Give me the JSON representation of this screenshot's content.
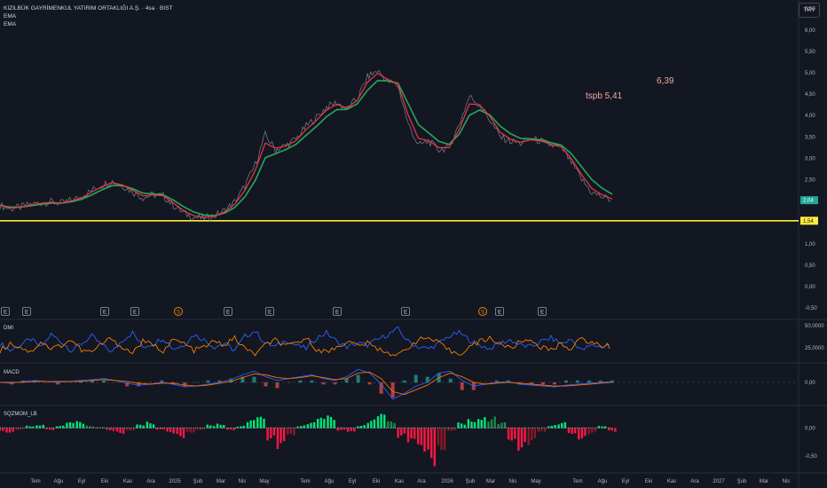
{
  "header": {
    "title": "KIZILBÜK GAYRİMENKUL YATIRIM ORTAKLIĞI A.Ş. · 4sa · BIST",
    "indicator1": "EMA",
    "indicator2": "EMA",
    "currency": "TRY"
  },
  "annotations": {
    "tspb": "tspb 5,41",
    "price_target": "6,39"
  },
  "colors": {
    "background": "#131722",
    "ema_fast": "#f23645",
    "ema_slow": "#26a65b",
    "support_line": "#ffeb3b",
    "dmi_plus": "#2962ff",
    "dmi_minus": "#f57c00",
    "squeeze_up": "#00e676",
    "squeeze_down": "#ff1744",
    "price_badge": "#26a69a"
  },
  "chart_data": [
    {
      "type": "line",
      "name": "price",
      "y_tick_labels": [
        "6,50",
        "6,00",
        "5,50",
        "5,00",
        "4,50",
        "4,00",
        "3,50",
        "3,00",
        "2,50",
        "2,00",
        "1,50",
        "1,00",
        "0,50",
        "0,00",
        "-0,50"
      ],
      "ylim": [
        -0.6,
        6.7
      ],
      "x_tick_labels": [
        "Tem",
        "Ağu",
        "Eyl",
        "Eki",
        "Kas",
        "Ara",
        "2025",
        "Şub",
        "Mar",
        "Nis",
        "May",
        "Tem",
        "Ağu",
        "Eyl",
        "Eki",
        "Kas",
        "Ara",
        "2026",
        "Şub",
        "Mar",
        "Nis",
        "May",
        "Tem",
        "Ağu",
        "Eyl",
        "Eki",
        "Kas",
        "Ara",
        "2027",
        "Şub",
        "Mar",
        "Nis"
      ],
      "series": [
        {
          "values": [
            1.9,
            1.82,
            1.86,
            1.92,
            1.96,
            1.98,
            1.95,
            2.02,
            2.1,
            2.25,
            2.38,
            2.46,
            2.36,
            2.22,
            2.08,
            2.15,
            2.12,
            1.9,
            1.72,
            1.62,
            1.6,
            1.65,
            1.78,
            1.98,
            2.35,
            2.85,
            3.55,
            3.2,
            3.3,
            3.45,
            3.75,
            3.95,
            4.2,
            4.3,
            4.15,
            4.4,
            4.9,
            5.05,
            4.8,
            4.7,
            3.8,
            3.3,
            3.4,
            3.2,
            3.25,
            3.8,
            4.45,
            4.25,
            3.9,
            3.5,
            3.4,
            3.35,
            3.45,
            3.4,
            3.3,
            3.25,
            2.9,
            2.5,
            2.2,
            2.1,
            2.02
          ]
        }
      ],
      "last_price": "2,04",
      "support_level": "1,54",
      "support_value": 1.54,
      "event_markers": [
        "E",
        "E",
        "E",
        "E",
        "S",
        "E",
        "E",
        "E",
        "E",
        "S",
        "E",
        "E"
      ]
    },
    {
      "type": "line",
      "name": "DMI",
      "y_tick_labels": [
        "50,0000",
        "25,0000"
      ],
      "series": [
        {
          "values": [
            30,
            22,
            28,
            35,
            25,
            40,
            32,
            22,
            30,
            38,
            28,
            20,
            34,
            42,
            26,
            30,
            36,
            24,
            28,
            40,
            34,
            26,
            30,
            22,
            38,
            44,
            30,
            26,
            34,
            28,
            24,
            36,
            42,
            32,
            26,
            30,
            28,
            34,
            40,
            46,
            32,
            26,
            24,
            30,
            38,
            42,
            34,
            28,
            24,
            30,
            34,
            28,
            26,
            32,
            36,
            30,
            34,
            22,
            28,
            26,
            30
          ]
        },
        {
          "values": [
            22,
            30,
            26,
            20,
            32,
            24,
            28,
            34,
            22,
            20,
            30,
            36,
            24,
            20,
            32,
            28,
            22,
            34,
            30,
            22,
            26,
            32,
            28,
            36,
            24,
            18,
            28,
            34,
            26,
            30,
            36,
            24,
            20,
            26,
            32,
            28,
            30,
            24,
            20,
            16,
            26,
            34,
            36,
            30,
            22,
            18,
            26,
            32,
            36,
            30,
            24,
            32,
            34,
            26,
            22,
            30,
            24,
            36,
            30,
            28,
            26
          ]
        }
      ]
    },
    {
      "type": "line",
      "name": "MACD",
      "y_tick_labels": [
        "0,00"
      ],
      "series": [
        {
          "values": [
            0.0,
            -0.01,
            0.01,
            0.02,
            0.01,
            0.0,
            0.01,
            0.02,
            0.03,
            0.04,
            0.02,
            -0.01,
            -0.03,
            -0.02,
            0.0,
            -0.02,
            -0.05,
            -0.04,
            -0.02,
            0.0,
            0.03,
            0.08,
            0.12,
            0.06,
            0.02,
            0.04,
            0.06,
            0.08,
            0.04,
            0.02,
            0.06,
            0.14,
            0.1,
            -0.02,
            -0.18,
            -0.12,
            -0.04,
            0.0,
            0.1,
            0.12,
            0.02,
            -0.04,
            -0.02,
            0.0,
            0.01,
            -0.02,
            -0.03,
            -0.04,
            -0.05,
            -0.03,
            -0.02,
            -0.01,
            0.0,
            0.01
          ]
        },
        {
          "values": [
            0.0,
            0.0,
            0.0,
            0.01,
            0.01,
            0.01,
            0.01,
            0.01,
            0.02,
            0.03,
            0.02,
            0.01,
            -0.01,
            -0.02,
            -0.01,
            -0.01,
            -0.03,
            -0.04,
            -0.03,
            -0.01,
            0.01,
            0.05,
            0.09,
            0.08,
            0.05,
            0.04,
            0.05,
            0.07,
            0.05,
            0.03,
            0.04,
            0.1,
            0.11,
            0.04,
            -0.1,
            -0.13,
            -0.08,
            -0.03,
            0.05,
            0.1,
            0.06,
            0.0,
            -0.02,
            -0.01,
            0.0,
            -0.01,
            -0.02,
            -0.03,
            -0.04,
            -0.04,
            -0.03,
            -0.02,
            -0.01,
            0.0
          ]
        }
      ]
    },
    {
      "type": "bar",
      "name": "SQZMOM_LB",
      "y_tick_labels": [
        "0,00",
        "-0,50"
      ],
      "values": [
        -0.05,
        -0.08,
        -0.03,
        0.05,
        0.08,
        -0.04,
        0.04,
        0.1,
        0.12,
        0.05,
        0.02,
        -0.06,
        -0.1,
        -0.04,
        0.06,
        0.12,
        -0.04,
        -0.12,
        -0.18,
        -0.08,
        -0.03,
        0.06,
        0.1,
        -0.05,
        0.04,
        0.14,
        0.2,
        -0.22,
        -0.45,
        -0.2,
        0.05,
        0.1,
        0.18,
        0.22,
        -0.05,
        -0.1,
        0.06,
        0.15,
        0.25,
        0.12,
        -0.18,
        -0.35,
        -0.55,
        -0.7,
        -0.4,
        -0.05,
        0.1,
        0.2,
        0.28,
        0.22,
        0.1,
        -0.22,
        -0.4,
        -0.35,
        -0.1,
        0.06,
        0.1,
        -0.1,
        -0.2,
        -0.12,
        0.05,
        -0.08
      ]
    }
  ]
}
